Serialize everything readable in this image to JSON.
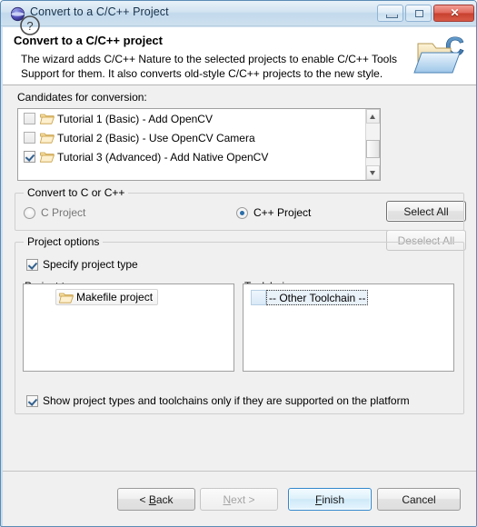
{
  "window": {
    "title": "Convert to a C/C++ Project",
    "icon": "eclipse-globe-icon",
    "controls": {
      "minimize": "minimize-icon",
      "maximize": "maximize-icon",
      "close_glyph": "✕"
    }
  },
  "header": {
    "title": "Convert to a C/C++ project",
    "description": "The wizard adds C/C++ Nature to the selected projects to enable C/C++ Tools Support for them. It also converts old-style C/C++ projects to the new style.",
    "icon": "folder-c-banner-icon"
  },
  "candidates": {
    "label": "Candidates for conversion:",
    "items": [
      {
        "checked": false,
        "label": "Tutorial 1 (Basic) - Add OpenCV"
      },
      {
        "checked": false,
        "label": "Tutorial 2 (Basic) - Use OpenCV Camera"
      },
      {
        "checked": true,
        "label": "Tutorial 3 (Advanced) - Add Native OpenCV"
      }
    ],
    "select_all_label": "Select All",
    "deselect_all_label": "Deselect All",
    "deselect_all_enabled": false
  },
  "convert_group": {
    "title": "Convert to C or C++",
    "options": [
      {
        "label": "C Project",
        "selected": false
      },
      {
        "label": "C++ Project",
        "selected": true
      }
    ]
  },
  "project_options": {
    "title": "Project options",
    "specify_checkbox": {
      "label": "Specify project type",
      "checked": true
    },
    "project_type_label": "Project type:",
    "toolchains_label": "Toolchains:",
    "project_types": [
      {
        "label": "Makefile project",
        "selected": true,
        "icon": "folder-icon"
      }
    ],
    "toolchains": [
      {
        "label": "-- Other Toolchain --",
        "selected": true,
        "focused": true
      }
    ],
    "show_supported_checkbox": {
      "label": "Show project types and toolchains only if they are supported on the platform",
      "checked": true
    }
  },
  "footer": {
    "help_icon": "question-mark-icon",
    "buttons": [
      {
        "id": "back",
        "label": "< Back",
        "mnemonic": "B",
        "enabled": true,
        "primary": false
      },
      {
        "id": "next",
        "label": "Next >",
        "mnemonic": "N",
        "enabled": false,
        "primary": false
      },
      {
        "id": "finish",
        "label": "Finish",
        "mnemonic": "F",
        "enabled": true,
        "primary": true
      },
      {
        "id": "cancel",
        "label": "Cancel",
        "mnemonic": "",
        "enabled": true,
        "primary": false
      }
    ]
  },
  "colors": {
    "dialog_bg": "#f0f0f0",
    "header_bg": "#ffffff",
    "accent_blue": "#2f87cc",
    "close_red": "#c8412f",
    "title_text": "#16314a"
  }
}
